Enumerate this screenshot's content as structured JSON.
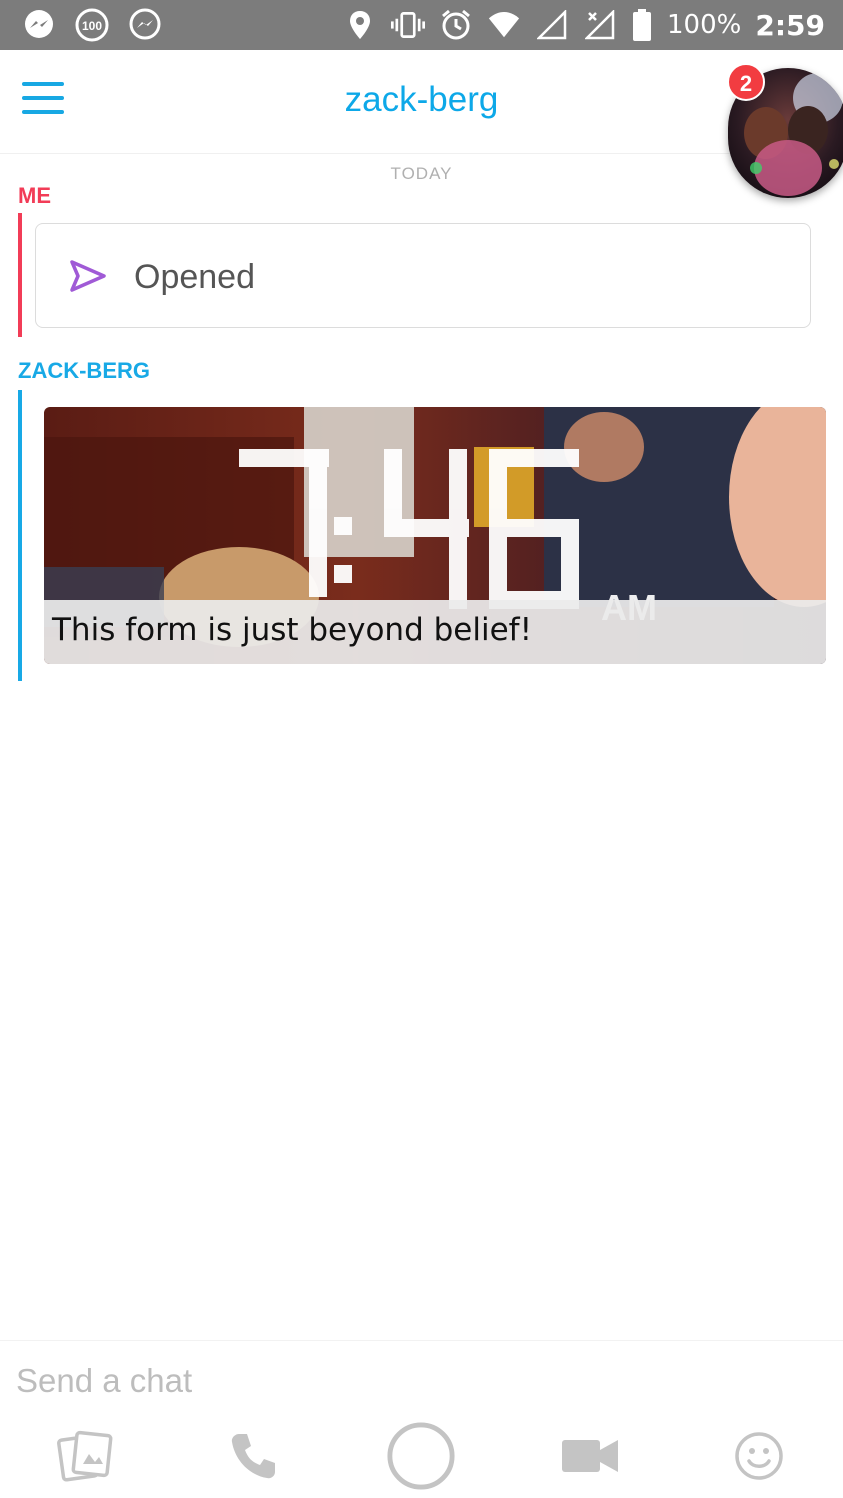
{
  "status_bar": {
    "battery_text": "100%",
    "time": "2:59",
    "notif_count": "100",
    "icons_left": [
      "messenger-icon",
      "notification-100-icon",
      "messenger-outline-icon"
    ],
    "icons_right": [
      "location-icon",
      "vibrate-icon",
      "alarm-icon",
      "wifi-icon",
      "signal-icon",
      "no-signal-icon",
      "battery-icon"
    ]
  },
  "header": {
    "title": "zack-berg",
    "badge_count": "2"
  },
  "chat": {
    "day_label": "TODAY",
    "me_label": "ME",
    "opened_text": "Opened",
    "friend_label": "ZACK-BERG",
    "snap_caption": "This form is just beyond belief!",
    "snap_time_suffix": "AM",
    "snap_time_digits": "7:46"
  },
  "composer": {
    "placeholder": "Send a chat",
    "buttons": [
      "memories-icon",
      "phone-icon",
      "camera-shutter-icon",
      "video-icon",
      "emoji-icon"
    ]
  },
  "colors": {
    "accent_blue": "#0da8e8",
    "me_red": "#f23c57",
    "opened_purple": "#a05ad6",
    "status_gray": "#7c7c7c",
    "badge_red": "#f23c41"
  }
}
